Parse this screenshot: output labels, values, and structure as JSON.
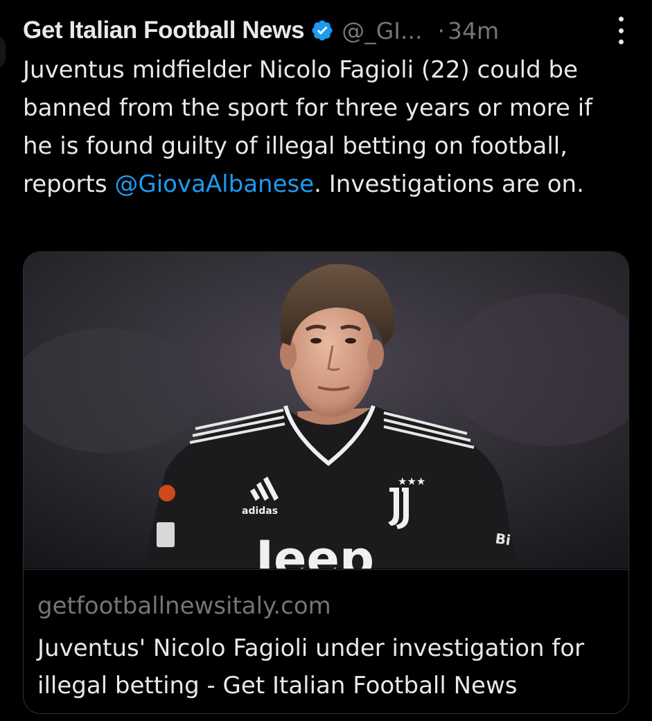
{
  "author": {
    "name": "Get Italian Football News",
    "handle": "@_GI...",
    "time": "34m",
    "separator": "·"
  },
  "tweet": {
    "text_before": "Juventus midfielder Nicolo Fagioli (22) could be banned from the sport for three years or more if he is found guilty of illegal betting on football, reports ",
    "mention": "@GiovaAlbanese",
    "text_after": ". Investigations are on."
  },
  "card": {
    "domain": "getfootballnewsitaly.com",
    "title": "Juventus' Nicolo Fagioli under investigation for illegal betting - Get Italian Football News",
    "photo": {
      "kit_brand": "adidas",
      "kit_sponsor": "Jeep",
      "crest_stars": "★★★"
    }
  },
  "icons": {
    "verified": "verified-badge-icon",
    "more": "more-options-icon"
  },
  "colors": {
    "background": "#000000",
    "text": "#e7e9ea",
    "secondary": "#71767b",
    "link": "#1d9bf0",
    "border": "#2f3336"
  }
}
